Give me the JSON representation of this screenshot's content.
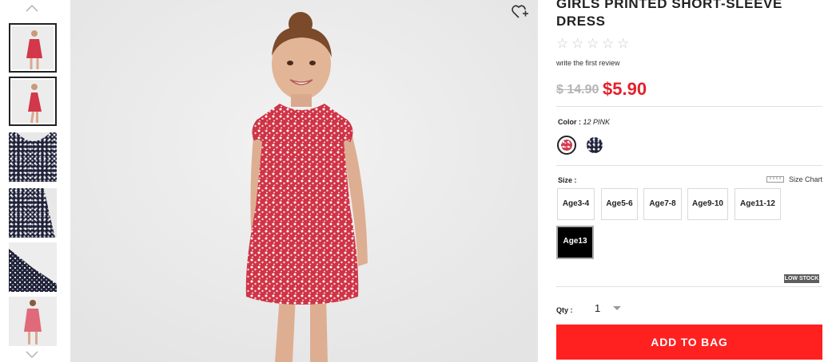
{
  "product": {
    "title": "GIRLS PRINTED SHORT-SLEEVE DRESS",
    "rating_stars": 0,
    "review_link": "write the first review",
    "price_original": "$ 14.90",
    "price_sale": "$5.90"
  },
  "color": {
    "label": "Color :",
    "selected_value": "12 PINK",
    "swatches": [
      "12 PINK",
      "navy floral"
    ]
  },
  "size": {
    "label": "Size :",
    "chart_label": "Size Chart",
    "options": [
      "Age3-4",
      "Age5-6",
      "Age7-8",
      "Age9-10",
      "Age11-12",
      "Age13"
    ],
    "selected": "Age13",
    "stock_badge": "LOW STOCK"
  },
  "quantity": {
    "label": "Qty :",
    "value": "1"
  },
  "cta": {
    "add_to_bag": "ADD TO BAG"
  },
  "gallery": {
    "thumbnail_count": 6,
    "active_thumbnail": 2
  },
  "colors": {
    "brand_red": "#ff2020",
    "sale_red": "#e4202b",
    "dress_red": "#d2374a",
    "navy_print": "#1f2238"
  }
}
